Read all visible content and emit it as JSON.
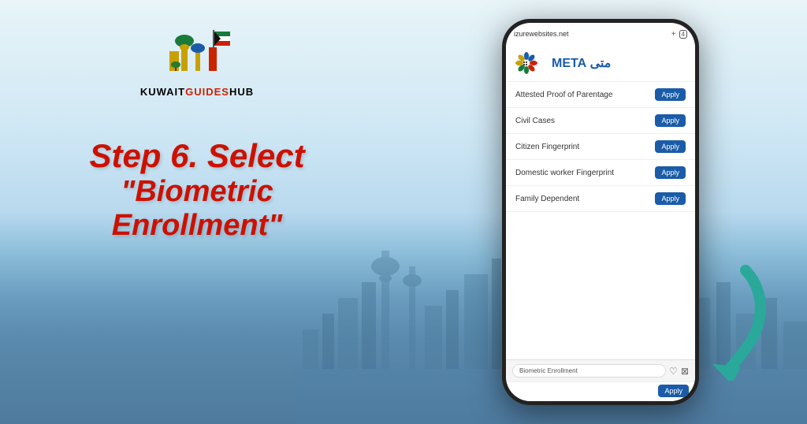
{
  "background": {
    "alt": "Kuwait city skyline"
  },
  "logo": {
    "brand_text": "KUWAITGUIDESHUB",
    "kuwait": "KUWAIT",
    "guides": "GUIDES",
    "hub": "HUB"
  },
  "step": {
    "line1": "Step 6. Select",
    "line2": "\"Biometric",
    "line3": "Enrollment\""
  },
  "phone": {
    "url": "izurewebsites.net",
    "plus_icon": "+",
    "tab_count": "4",
    "meta_logo_text": "متى META",
    "search_placeholder": "Biometric Enrollment",
    "services": [
      {
        "name": "Attested Proof of Parentage",
        "button": "Apply"
      },
      {
        "name": "Civil Cases",
        "button": "Apply"
      },
      {
        "name": "Citizen Fingerprint",
        "button": "Apply"
      },
      {
        "name": "Domestic worker Fingerprint",
        "button": "Apply"
      },
      {
        "name": "Family Dependent",
        "button": "Apply"
      },
      {
        "name": "Biometric Enrollment",
        "button": "Apply"
      }
    ],
    "heart_icon": "♡",
    "filter_icon": "⊠"
  }
}
